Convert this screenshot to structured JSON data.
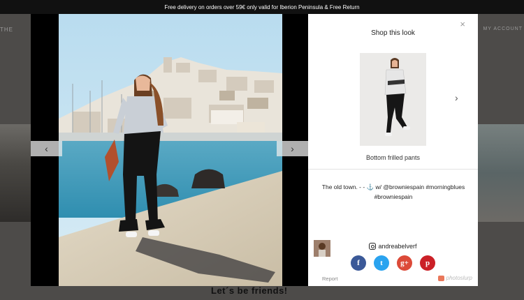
{
  "banner": {
    "text": "Free delivery on orders over 59€ only valid for Iberion Peninsula & Free Return"
  },
  "background": {
    "nav_left": "THE",
    "nav_right": "MY ACCOUNT",
    "friends_heading": "Let´s be friends!"
  },
  "modal": {
    "photo_alt": "woman on pier",
    "prev_icon": "chevron-left-icon",
    "next_icon": "chevron-right-icon",
    "prev_glyph": "‹",
    "next_glyph": "›"
  },
  "panel": {
    "close_glyph": "×",
    "title": "Shop this look",
    "product_next_glyph": "›",
    "product_name": "Bottom frilled pants",
    "caption": "The old town. - - ⚓ w/ @browniespain #morningblues #browniespain",
    "username": "andreabelverf",
    "socials": [
      {
        "name": "facebook",
        "glyph": "f",
        "color": "#3b5998"
      },
      {
        "name": "twitter",
        "glyph": "t",
        "color": "#2aa3ef"
      },
      {
        "name": "google-plus",
        "glyph": "g+",
        "color": "#dc4a38"
      },
      {
        "name": "pinterest",
        "glyph": "p",
        "color": "#cb2027"
      }
    ],
    "report_label": "Report",
    "brand_label": "photoslurp"
  }
}
